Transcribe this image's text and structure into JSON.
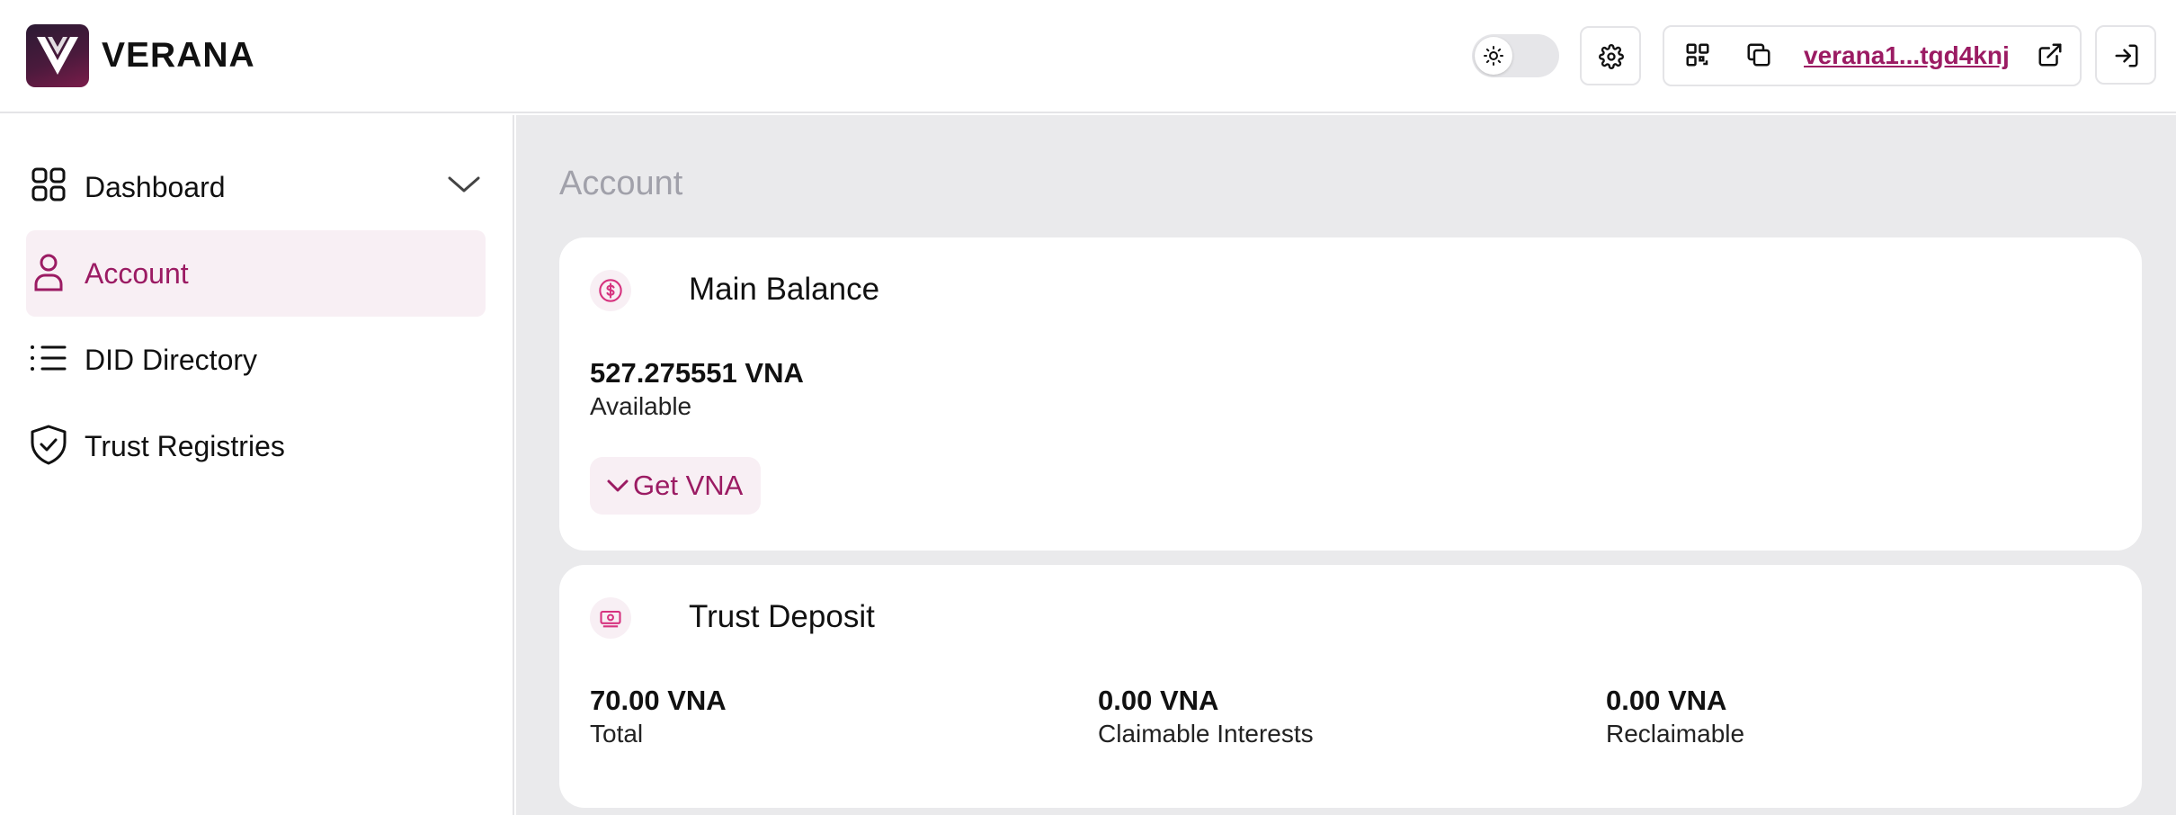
{
  "brand": {
    "name": "VERANA"
  },
  "header": {
    "wallet_address": "verana1...tgd4knj"
  },
  "sidebar": {
    "items": [
      {
        "label": "Dashboard",
        "icon": "grid-icon",
        "active": false,
        "expandable": true
      },
      {
        "label": "Account",
        "icon": "user-icon",
        "active": true
      },
      {
        "label": "DID Directory",
        "icon": "list-icon",
        "active": false
      },
      {
        "label": "Trust Registries",
        "icon": "shield-check-icon",
        "active": false
      }
    ]
  },
  "main": {
    "page_title": "Account",
    "main_balance": {
      "title": "Main Balance",
      "icon": "dollar-circle-icon",
      "amount": "527.275551 VNA",
      "amount_caption": "Available",
      "action_label": "Get VNA"
    },
    "trust_deposit": {
      "title": "Trust Deposit",
      "icon": "banknote-icon",
      "stats": [
        {
          "value": "70.00 VNA",
          "caption": "Total"
        },
        {
          "value": "0.00 VNA",
          "caption": "Claimable Interests"
        },
        {
          "value": "0.00 VNA",
          "caption": "Reclaimable"
        }
      ]
    }
  },
  "colors": {
    "accent": "#9b1b63",
    "accent_soft": "#f8eff4",
    "main_bg": "#eaeaec",
    "border": "#e4e4e7"
  }
}
